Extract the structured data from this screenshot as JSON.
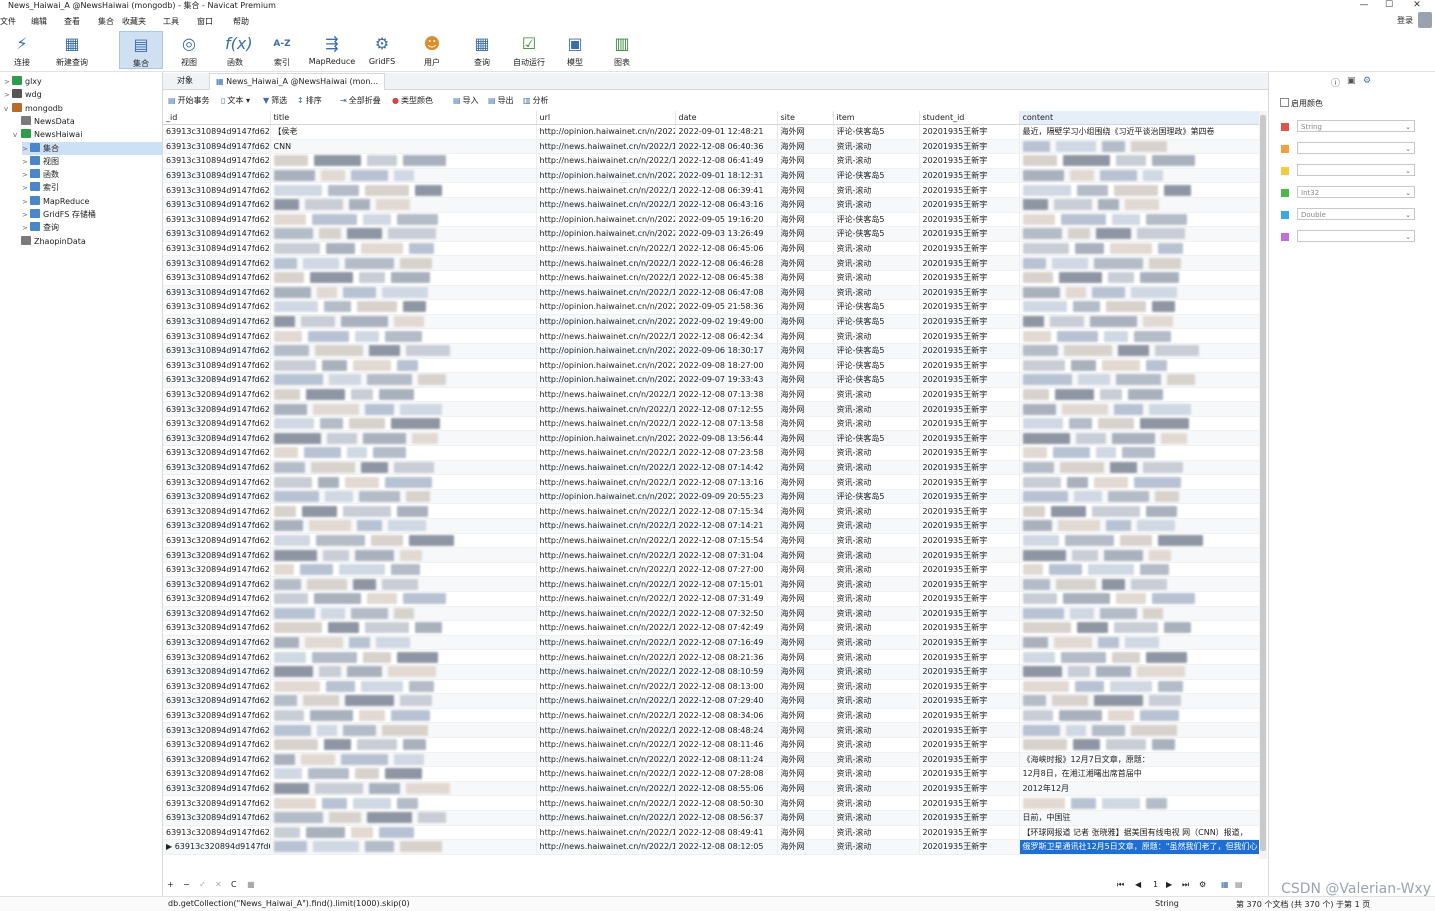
{
  "window": {
    "title": "News_Haiwai_A @NewsHaiwai (mongodb) - 集合 - Navicat Premium",
    "minimize": "—",
    "maximize": "☐",
    "close": "✕"
  },
  "menu": [
    "文件",
    "编辑",
    "查看",
    "集合",
    "收藏夹",
    "工具",
    "窗口",
    "帮助"
  ],
  "login": "登录",
  "toolbar": [
    {
      "label": "连接",
      "icon": "plug-icon"
    },
    {
      "label": "新建查询",
      "icon": "new-query-icon"
    },
    {
      "label": "集合",
      "icon": "collection-icon",
      "active": true
    },
    {
      "label": "视图",
      "icon": "view-icon"
    },
    {
      "label": "函数",
      "icon": "function-icon"
    },
    {
      "label": "索引",
      "icon": "index-icon"
    },
    {
      "label": "MapReduce",
      "icon": "mapreduce-icon"
    },
    {
      "label": "GridFS",
      "icon": "gridfs-icon"
    },
    {
      "label": "用户",
      "icon": "user-icon"
    },
    {
      "label": "查询",
      "icon": "query-icon"
    },
    {
      "label": "自动运行",
      "icon": "automation-icon"
    },
    {
      "label": "模型",
      "icon": "model-icon"
    },
    {
      "label": "图表",
      "icon": "chart-icon"
    }
  ],
  "tree": [
    {
      "label": "glxy",
      "level": 0,
      "caret": ">",
      "icon": "#2e9d4a"
    },
    {
      "label": "wdg",
      "level": 0,
      "caret": ">",
      "icon": "#555555"
    },
    {
      "label": "mongodb",
      "level": 0,
      "caret": "v",
      "icon": "#b86a2b"
    },
    {
      "label": "NewsData",
      "level": 1,
      "caret": "",
      "icon": "#7a7a7a"
    },
    {
      "label": "NewsHaiwai",
      "level": 1,
      "caret": "v",
      "icon": "#2e9d4a"
    },
    {
      "label": "集合",
      "level": 2,
      "caret": ">",
      "icon": "#4a86c8",
      "selected": true
    },
    {
      "label": "视图",
      "level": 2,
      "caret": ">",
      "icon": "#4a86c8"
    },
    {
      "label": "函数",
      "level": 2,
      "caret": ">",
      "icon": "#4a86c8"
    },
    {
      "label": "索引",
      "level": 2,
      "caret": ">",
      "icon": "#4a86c8"
    },
    {
      "label": "MapReduce",
      "level": 2,
      "caret": ">",
      "icon": "#4a86c8"
    },
    {
      "label": "GridFS 存储桶",
      "level": 2,
      "caret": ">",
      "icon": "#4a86c8"
    },
    {
      "label": "查询",
      "level": 2,
      "caret": ">",
      "icon": "#4a86c8"
    },
    {
      "label": "ZhaopinData",
      "level": 1,
      "caret": "",
      "icon": "#7a7a7a"
    }
  ],
  "tabs": {
    "objects": "对象",
    "active": "News_Haiwai_A @NewsHaiwai (mon..."
  },
  "subtoolbar": [
    {
      "label": "开始事务",
      "icon": "transaction-icon"
    },
    {
      "label": "文本 ▾",
      "icon": "text-icon"
    },
    {
      "label": "筛选",
      "icon": "filter-icon"
    },
    {
      "label": "排序",
      "icon": "sort-icon"
    },
    {
      "label": "全部折叠",
      "icon": "collapse-icon"
    },
    {
      "label": "类型颜色",
      "icon": "type-color-icon"
    },
    {
      "label": "导入",
      "icon": "import-icon"
    },
    {
      "label": "导出",
      "icon": "export-icon"
    },
    {
      "label": "分析",
      "icon": "analysis-icon"
    }
  ],
  "grid": {
    "columns": [
      "_id",
      "title",
      "url",
      "date",
      "site",
      "item",
      "student_id",
      "content"
    ],
    "rows": [
      {
        "id": "63913c310894d9147fd62",
        "title": "【侯老",
        "url": "http://opinion.haiwainet.cn/n/2022/",
        "date": "2022-09-01 12:48:21",
        "site": "海外网",
        "item": "评论-侠客岛5",
        "student": "20201935王新宇",
        "content": "最近，隔壁学习小组围绕《习近平谈治国理政》第四卷"
      },
      {
        "id": "63913c310894d9147fd62",
        "title": "CNN",
        "url": "http://news.haiwainet.cn/n/2022/12/",
        "date": "2022-12-08 06:40:36",
        "site": "海外网",
        "item": "资讯-滚动",
        "student": "20201935王新宇",
        "content": ""
      },
      {
        "id": "63913c310894d9147fd62",
        "title": "",
        "url": "http://news.haiwainet.cn/n/2022/12/",
        "date": "2022-12-08 06:41:49",
        "site": "海外网",
        "item": "资讯-滚动",
        "student": "20201935王新宇",
        "content": ""
      },
      {
        "id": "63913c310894d9147fd62",
        "title": "",
        "url": "http://opinion.haiwainet.cn/n/2022/",
        "date": "2022-09-01 18:12:31",
        "site": "海外网",
        "item": "评论-侠客岛5",
        "student": "20201935王新宇",
        "content": ""
      },
      {
        "id": "63913c310894d9147fd62",
        "title": "",
        "url": "http://news.haiwainet.cn/n/2022/12/",
        "date": "2022-12-08 06:39:41",
        "site": "海外网",
        "item": "资讯-滚动",
        "student": "20201935王新宇",
        "content": ""
      },
      {
        "id": "63913c310894d9147fd62",
        "title": "",
        "url": "http://news.haiwainet.cn/n/2022/12/",
        "date": "2022-12-08 06:43:16",
        "site": "海外网",
        "item": "资讯-滚动",
        "student": "20201935王新宇",
        "content": ""
      },
      {
        "id": "63913c310894d9147fd62",
        "title": "",
        "url": "http://opinion.haiwainet.cn/n/2022/",
        "date": "2022-09-05 19:16:20",
        "site": "海外网",
        "item": "评论-侠客岛5",
        "student": "20201935王新宇",
        "content": ""
      },
      {
        "id": "63913c310894d9147fd62",
        "title": "",
        "url": "http://opinion.haiwainet.cn/n/2022/",
        "date": "2022-09-03 13:26:49",
        "site": "海外网",
        "item": "评论-侠客岛5",
        "student": "20201935王新宇",
        "content": ""
      },
      {
        "id": "63913c310894d9147fd62",
        "title": "",
        "url": "http://news.haiwainet.cn/n/2022/12/",
        "date": "2022-12-08 06:45:06",
        "site": "海外网",
        "item": "资讯-滚动",
        "student": "20201935王新宇",
        "content": ""
      },
      {
        "id": "63913c310894d9147fd62",
        "title": "",
        "url": "http://news.haiwainet.cn/n/2022/12/",
        "date": "2022-12-08 06:46:28",
        "site": "海外网",
        "item": "资讯-滚动",
        "student": "20201935王新宇",
        "content": ""
      },
      {
        "id": "63913c310894d9147fd62",
        "title": "",
        "url": "http://news.haiwainet.cn/n/2022/12/",
        "date": "2022-12-08 06:45:38",
        "site": "海外网",
        "item": "资讯-滚动",
        "student": "20201935王新宇",
        "content": ""
      },
      {
        "id": "63913c310894d9147fd62",
        "title": "",
        "url": "http://news.haiwainet.cn/n/2022/12/",
        "date": "2022-12-08 06:47:08",
        "site": "海外网",
        "item": "资讯-滚动",
        "student": "20201935王新宇",
        "content": ""
      },
      {
        "id": "63913c310894d9147fd62",
        "title": "",
        "url": "http://opinion.haiwainet.cn/n/2022/",
        "date": "2022-09-05 21:58:36",
        "site": "海外网",
        "item": "评论-侠客岛5",
        "student": "20201935王新宇",
        "content": ""
      },
      {
        "id": "63913c310894d9147fd62",
        "title": "",
        "url": "http://opinion.haiwainet.cn/n/2022/",
        "date": "2022-09-02 19:49:00",
        "site": "海外网",
        "item": "评论-侠客岛5",
        "student": "20201935王新宇",
        "content": ""
      },
      {
        "id": "63913c310894d9147fd62",
        "title": "",
        "url": "http://news.haiwainet.cn/n/2022/12/",
        "date": "2022-12-08 06:42:34",
        "site": "海外网",
        "item": "资讯-滚动",
        "student": "20201935王新宇",
        "content": ""
      },
      {
        "id": "63913c310894d9147fd62",
        "title": "",
        "url": "http://opinion.haiwainet.cn/n/2022/",
        "date": "2022-09-06 18:30:17",
        "site": "海外网",
        "item": "评论-侠客岛5",
        "student": "20201935王新宇",
        "content": ""
      },
      {
        "id": "63913c310894d9147fd62",
        "title": "",
        "url": "http://opinion.haiwainet.cn/n/2022/",
        "date": "2022-09-08 18:27:00",
        "site": "海外网",
        "item": "评论-侠客岛5",
        "student": "20201935王新宇",
        "content": ""
      },
      {
        "id": "63913c320894d9147fd62",
        "title": "",
        "url": "http://opinion.haiwainet.cn/n/2022/",
        "date": "2022-09-07 19:33:43",
        "site": "海外网",
        "item": "评论-侠客岛5",
        "student": "20201935王新宇",
        "content": ""
      },
      {
        "id": "63913c320894d9147fd62",
        "title": "",
        "url": "http://news.haiwainet.cn/n/2022/12/",
        "date": "2022-12-08 07:13:38",
        "site": "海外网",
        "item": "资讯-滚动",
        "student": "20201935王新宇",
        "content": ""
      },
      {
        "id": "63913c320894d9147fd62",
        "title": "",
        "url": "http://news.haiwainet.cn/n/2022/12/",
        "date": "2022-12-08 07:12:55",
        "site": "海外网",
        "item": "资讯-滚动",
        "student": "20201935王新宇",
        "content": ""
      },
      {
        "id": "63913c320894d9147fd62",
        "title": "",
        "url": "http://news.haiwainet.cn/n/2022/12/",
        "date": "2022-12-08 07:13:58",
        "site": "海外网",
        "item": "资讯-滚动",
        "student": "20201935王新宇",
        "content": ""
      },
      {
        "id": "63913c320894d9147fd62",
        "title": "",
        "url": "http://opinion.haiwainet.cn/n/2022/",
        "date": "2022-09-08 13:56:44",
        "site": "海外网",
        "item": "评论-侠客岛5",
        "student": "20201935王新宇",
        "content": ""
      },
      {
        "id": "63913c320894d9147fd62",
        "title": "",
        "url": "http://news.haiwainet.cn/n/2022/12/",
        "date": "2022-12-08 07:23:58",
        "site": "海外网",
        "item": "资讯-滚动",
        "student": "20201935王新宇",
        "content": ""
      },
      {
        "id": "63913c320894d9147fd62",
        "title": "",
        "url": "http://news.haiwainet.cn/n/2022/12/",
        "date": "2022-12-08 07:14:42",
        "site": "海外网",
        "item": "资讯-滚动",
        "student": "20201935王新宇",
        "content": ""
      },
      {
        "id": "63913c320894d9147fd62",
        "title": "",
        "url": "http://news.haiwainet.cn/n/2022/12/",
        "date": "2022-12-08 07:13:16",
        "site": "海外网",
        "item": "资讯-滚动",
        "student": "20201935王新宇",
        "content": ""
      },
      {
        "id": "63913c320894d9147fd62",
        "title": "",
        "url": "http://opinion.haiwainet.cn/n/2022/",
        "date": "2022-09-09 20:55:23",
        "site": "海外网",
        "item": "评论-侠客岛5",
        "student": "20201935王新宇",
        "content": ""
      },
      {
        "id": "63913c320894d9147fd62",
        "title": "",
        "url": "http://news.haiwainet.cn/n/2022/12/",
        "date": "2022-12-08 07:15:34",
        "site": "海外网",
        "item": "资讯-滚动",
        "student": "20201935王新宇",
        "content": ""
      },
      {
        "id": "63913c320894d9147fd62",
        "title": "",
        "url": "http://news.haiwainet.cn/n/2022/12/",
        "date": "2022-12-08 07:14:21",
        "site": "海外网",
        "item": "资讯-滚动",
        "student": "20201935王新宇",
        "content": ""
      },
      {
        "id": "63913c320894d9147fd62",
        "title": "",
        "url": "http://news.haiwainet.cn/n/2022/12/",
        "date": "2022-12-08 07:15:54",
        "site": "海外网",
        "item": "资讯-滚动",
        "student": "20201935王新宇",
        "content": ""
      },
      {
        "id": "63913c320894d9147fd62",
        "title": "",
        "url": "http://news.haiwainet.cn/n/2022/12/",
        "date": "2022-12-08 07:31:04",
        "site": "海外网",
        "item": "资讯-滚动",
        "student": "20201935王新宇",
        "content": ""
      },
      {
        "id": "63913c320894d9147fd62",
        "title": "",
        "url": "http://news.haiwainet.cn/n/2022/12/",
        "date": "2022-12-08 07:27:00",
        "site": "海外网",
        "item": "资讯-滚动",
        "student": "20201935王新宇",
        "content": ""
      },
      {
        "id": "63913c320894d9147fd62",
        "title": "",
        "url": "http://news.haiwainet.cn/n/2022/12/",
        "date": "2022-12-08 07:15:01",
        "site": "海外网",
        "item": "资讯-滚动",
        "student": "20201935王新宇",
        "content": ""
      },
      {
        "id": "63913c320894d9147fd62",
        "title": "",
        "url": "http://news.haiwainet.cn/n/2022/12/",
        "date": "2022-12-08 07:31:49",
        "site": "海外网",
        "item": "资讯-滚动",
        "student": "20201935王新宇",
        "content": ""
      },
      {
        "id": "63913c320894d9147fd62",
        "title": "",
        "url": "http://news.haiwainet.cn/n/2022/12/",
        "date": "2022-12-08 07:32:50",
        "site": "海外网",
        "item": "资讯-滚动",
        "student": "20201935王新宇",
        "content": ""
      },
      {
        "id": "63913c320894d9147fd62",
        "title": "",
        "url": "http://news.haiwainet.cn/n/2022/12/",
        "date": "2022-12-08 07:42:49",
        "site": "海外网",
        "item": "资讯-滚动",
        "student": "20201935王新宇",
        "content": ""
      },
      {
        "id": "63913c320894d9147fd62",
        "title": "",
        "url": "http://news.haiwainet.cn/n/2022/12/",
        "date": "2022-12-08 07:16:49",
        "site": "海外网",
        "item": "资讯-滚动",
        "student": "20201935王新宇",
        "content": ""
      },
      {
        "id": "63913c320894d9147fd62",
        "title": "",
        "url": "http://news.haiwainet.cn/n/2022/12/",
        "date": "2022-12-08 08:21:36",
        "site": "海外网",
        "item": "资讯-滚动",
        "student": "20201935王新宇",
        "content": ""
      },
      {
        "id": "63913c320894d9147fd62",
        "title": "",
        "url": "http://news.haiwainet.cn/n/2022/12/",
        "date": "2022-12-08 08:10:59",
        "site": "海外网",
        "item": "资讯-滚动",
        "student": "20201935王新宇",
        "content": ""
      },
      {
        "id": "63913c320894d9147fd62",
        "title": "",
        "url": "http://news.haiwainet.cn/n/2022/12/",
        "date": "2022-12-08 08:13:00",
        "site": "海外网",
        "item": "资讯-滚动",
        "student": "20201935王新宇",
        "content": ""
      },
      {
        "id": "63913c320894d9147fd62",
        "title": "",
        "url": "http://news.haiwainet.cn/n/2022/12/",
        "date": "2022-12-08 07:29:40",
        "site": "海外网",
        "item": "资讯-滚动",
        "student": "20201935王新宇",
        "content": ""
      },
      {
        "id": "63913c320894d9147fd62",
        "title": "",
        "url": "http://news.haiwainet.cn/n/2022/12/",
        "date": "2022-12-08 08:34:06",
        "site": "海外网",
        "item": "资讯-滚动",
        "student": "20201935王新宇",
        "content": ""
      },
      {
        "id": "63913c320894d9147fd62",
        "title": "",
        "url": "http://news.haiwainet.cn/n/2022/12/",
        "date": "2022-12-08 08:48:24",
        "site": "海外网",
        "item": "资讯-滚动",
        "student": "20201935王新宇",
        "content": ""
      },
      {
        "id": "63913c320894d9147fd62",
        "title": "",
        "url": "http://news.haiwainet.cn/n/2022/12/",
        "date": "2022-12-08 08:11:46",
        "site": "海外网",
        "item": "资讯-滚动",
        "student": "20201935王新宇",
        "content": ""
      },
      {
        "id": "63913c320894d9147fd62",
        "title": "",
        "url": "http://news.haiwainet.cn/n/2022/12/",
        "date": "2022-12-08 08:11:24",
        "site": "海外网",
        "item": "资讯-滚动",
        "student": "20201935王新宇",
        "content": "《海峡时报》12月7日文章，原题："
      },
      {
        "id": "63913c320894d9147fd62",
        "title": "",
        "url": "http://news.haiwainet.cn/n/2022/12/",
        "date": "2022-12-08 07:28:08",
        "site": "海外网",
        "item": "资讯-滚动",
        "student": "20201935王新宇",
        "content": "12月8日，在湘江湘曙出席首届中"
      },
      {
        "id": "63913c320894d9147fd62",
        "title": "",
        "url": "http://news.haiwainet.cn/n/2022/12/",
        "date": "2022-12-08 08:55:06",
        "site": "海外网",
        "item": "资讯-滚动",
        "student": "20201935王新宇",
        "content": "2012年12月"
      },
      {
        "id": "63913c320894d9147fd62",
        "title": "",
        "url": "http://news.haiwainet.cn/n/2022/12/",
        "date": "2022-12-08 08:50:30",
        "site": "海外网",
        "item": "资讯-滚动",
        "student": "20201935王新宇",
        "content": ""
      },
      {
        "id": "63913c320894d9147fd62",
        "title": "",
        "url": "http://news.haiwainet.cn/n/2022/12/",
        "date": "2022-12-08 08:56:37",
        "site": "海外网",
        "item": "资讯-滚动",
        "student": "20201935王新宇",
        "content": "日前，中国驻"
      },
      {
        "id": "63913c320894d9147fd62",
        "title": "",
        "url": "http://news.haiwainet.cn/n/2022/12/",
        "date": "2022-12-08 08:49:41",
        "site": "海外网",
        "item": "资讯-滚动",
        "student": "20201935王新宇",
        "content": "【环球网报道 记者 张晓雅】据美国有线电视 网（CNN）报道，"
      },
      {
        "id": "63913c320894d9147fd62",
        "title": "",
        "url": "http://news.haiwainet.cn/n/2022/12/",
        "date": "2022-12-08 08:12:05",
        "site": "海外网",
        "item": "资讯-滚动",
        "student": "20201935王新宇",
        "content": "俄罗斯卫星通讯社12月5日文章，原题：\"虽然我们老了，但我们心",
        "selected": true
      }
    ]
  },
  "footer": {
    "add": "+",
    "remove": "−",
    "apply": "✓",
    "discard": "✕",
    "refresh": "C",
    "stop": "■",
    "page": "1",
    "first": "⏮",
    "prev": "◀",
    "next": "▶",
    "last": "⏭",
    "settings": "⚙"
  },
  "status": {
    "query": "db.getCollection(\"News_Haiwai_A\").find().limit(1000).skip(0)",
    "type": "String",
    "summary": "第 370 个文档 (共 370 个) 于第 1 页"
  },
  "rightpanel": {
    "enable_color": "启用颜色",
    "rows": [
      {
        "color": "#e05252",
        "value": "String"
      },
      {
        "color": "#f0a040",
        "value": ""
      },
      {
        "color": "#f2cc40",
        "value": ""
      },
      {
        "color": "#4cb64c",
        "value": "Int32"
      },
      {
        "color": "#3aa9e0",
        "value": "Double"
      },
      {
        "color": "#c070d8",
        "value": ""
      }
    ]
  },
  "watermark": "CSDN @Valerian-Wxy"
}
